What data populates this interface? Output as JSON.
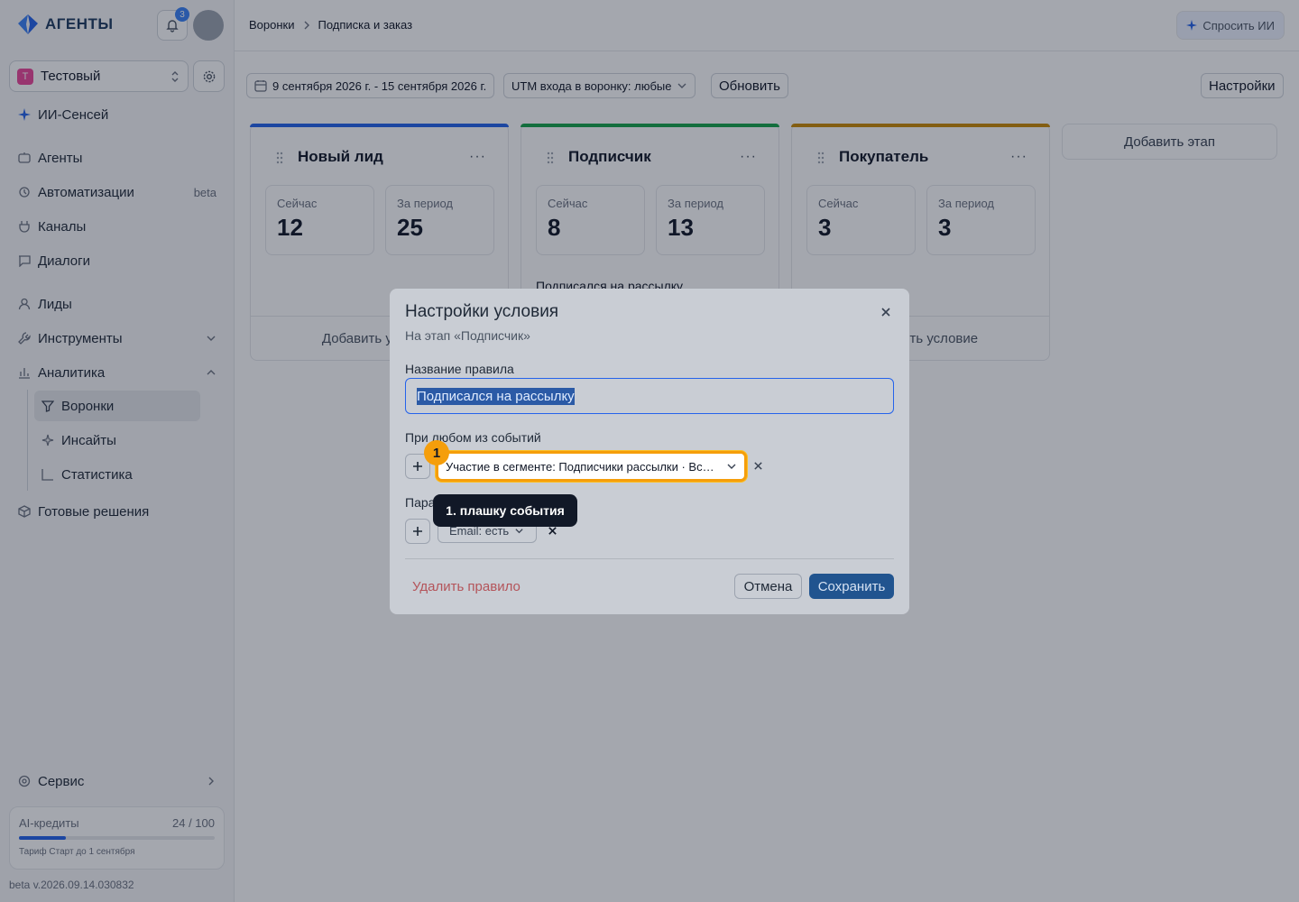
{
  "app": {
    "brand": "АГЕНТЫ",
    "notifications_count": "3"
  },
  "workspace": {
    "badge": "Т",
    "name": "Тестовый"
  },
  "sidebar": {
    "items": [
      {
        "label": "ИИ-Сенсей"
      },
      {
        "label": "Агенты"
      },
      {
        "label": "Автоматизации",
        "tag": "beta"
      },
      {
        "label": "Каналы"
      },
      {
        "label": "Диалоги"
      },
      {
        "label": "Лиды"
      },
      {
        "label": "Инструменты"
      },
      {
        "label": "Аналитика"
      },
      {
        "label": "Воронки"
      },
      {
        "label": "Инсайты"
      },
      {
        "label": "Статистика"
      },
      {
        "label": "Готовые решения"
      },
      {
        "label": "Сервис"
      }
    ],
    "credits": {
      "label": "AI-кредиты",
      "value": "24 / 100",
      "used_fraction": 0.24,
      "plan": "Тариф Старт до 1 сентября"
    },
    "version": "beta v.2026.09.14.030832"
  },
  "header": {
    "breadcrumb": [
      "Воронки",
      "Подписка и заказ"
    ],
    "ask_ai": "Спросить ИИ"
  },
  "toolbar": {
    "date_range": "9 сентября 2026 г. - 15 сентября 2026 г.",
    "utm_filter": "UTM входа в воронку: любые",
    "refresh": "Обновить",
    "settings": "Настройки"
  },
  "stages": [
    {
      "title": "Новый лид",
      "color": "#2563eb",
      "now_label": "Сейчас",
      "now": "12",
      "period_label": "За период",
      "period": "25",
      "rule": "",
      "add_condition": "Добавить условие"
    },
    {
      "title": "Подписчик",
      "color": "#16a34a",
      "now_label": "Сейчас",
      "now": "8",
      "period_label": "За период",
      "period": "13",
      "rule": "Подписался на рассылку",
      "add_condition": ""
    },
    {
      "title": "Покупатель",
      "color": "#ca8a04",
      "now_label": "Сейчас",
      "now": "3",
      "period_label": "За период",
      "period": "3",
      "rule": "",
      "add_condition": "Добавить условие"
    }
  ],
  "add_stage": "Добавить этап",
  "modal": {
    "title": "Настройки условия",
    "subtitle": "На этап «Подписчик»",
    "rule_name_label": "Название правила",
    "rule_name_value": "Подписался на рассылку",
    "events_label": "При любом из событий",
    "event_value": "Участие в сегменте: Подписчики рассылки · Вступил",
    "params_label": "Параметры",
    "param_chip": "Email: есть",
    "delete_label": "Удалить правило",
    "cancel_label": "Отмена",
    "save_label": "Сохранить"
  },
  "tutorial": {
    "step_number": "1",
    "tooltip": "1. плашку события",
    "highlight_color": "#f59e0b"
  }
}
